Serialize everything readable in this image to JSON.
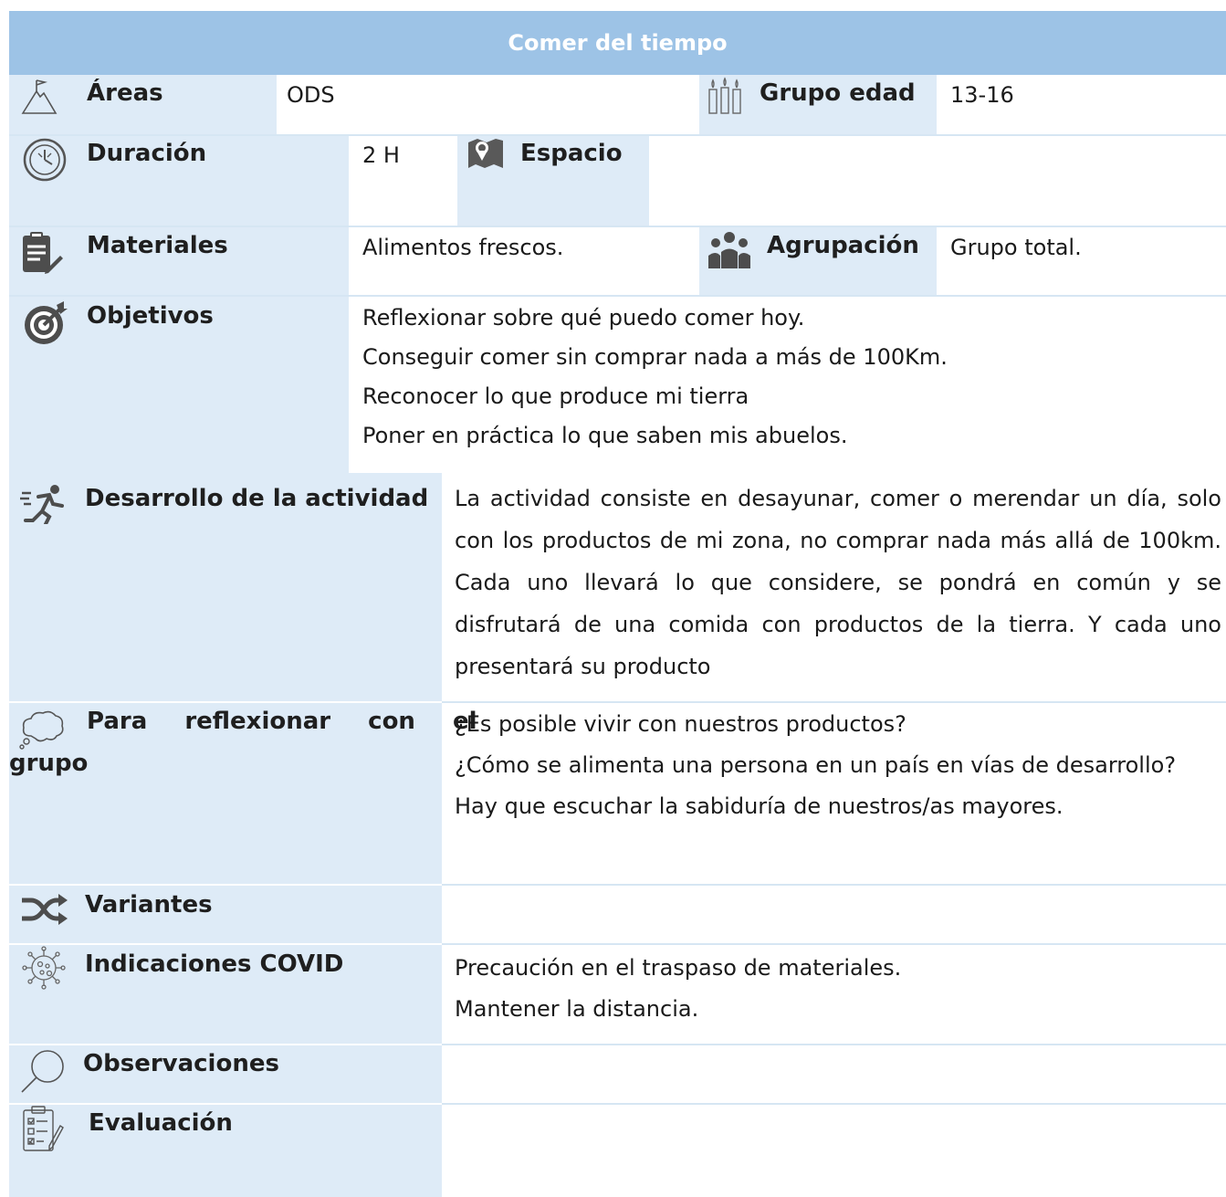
{
  "title": "Comer del tiempo",
  "rows": {
    "areas": {
      "label": "Áreas",
      "value": "ODS",
      "icon": "mountain-flag-icon"
    },
    "grupo_edad": {
      "label": "Grupo edad",
      "value": "13-16",
      "icon": "candles-icon"
    },
    "duracion": {
      "label": "Duración",
      "value": "2 H",
      "icon": "clock-icon"
    },
    "espacio": {
      "label": "Espacio",
      "value": "",
      "icon": "map-pin-icon"
    },
    "materiales": {
      "label": "Materiales",
      "value": "Alimentos frescos.",
      "icon": "clipboard-pencil-icon"
    },
    "agrupacion": {
      "label": "Agrupación",
      "value": "Grupo total.",
      "icon": "people-group-icon"
    },
    "objetivos": {
      "label": "Objetivos",
      "icon": "target-icon",
      "items": [
        "Reflexionar sobre qué puedo comer hoy.",
        "Conseguir comer sin comprar nada a más de 100Km.",
        "Reconocer lo que produce mi tierra",
        "Poner en práctica lo que saben mis abuelos."
      ]
    },
    "desarrollo": {
      "label": "Desarrollo de la actividad",
      "icon": "running-icon",
      "text": "La actividad consiste en desayunar, comer o merendar un día, solo con los productos de mi zona, no comprar nada más allá de 100km. Cada uno llevará lo que considere, se pondrá en común y se disfrutará de una comida con productos de la tierra. Y cada uno presentará su producto"
    },
    "reflexionar": {
      "label_line1": "Para reflexionar con el",
      "label_line2": "grupo",
      "icon": "thought-cloud-icon",
      "items": [
        "¿Es posible vivir con nuestros productos?",
        "¿Cómo se alimenta una persona en un país en vías de desarrollo?",
        "Hay que escuchar la sabiduría de nuestros/as mayores."
      ]
    },
    "variantes": {
      "label": "Variantes",
      "value": "",
      "icon": "shuffle-icon"
    },
    "covid": {
      "label": "Indicaciones COVID",
      "icon": "virus-icon",
      "items": [
        "Precaución en el traspaso de materiales.",
        "Mantener la distancia."
      ]
    },
    "observaciones": {
      "label": "Observaciones",
      "value": "",
      "icon": "magnifier-icon"
    },
    "evaluacion": {
      "label": "Evaluación",
      "value": "",
      "icon": "checklist-icon"
    }
  },
  "colors": {
    "header": "#9dc3e6",
    "label_bg": "#deebf7",
    "divider": "#d6e6f3"
  }
}
